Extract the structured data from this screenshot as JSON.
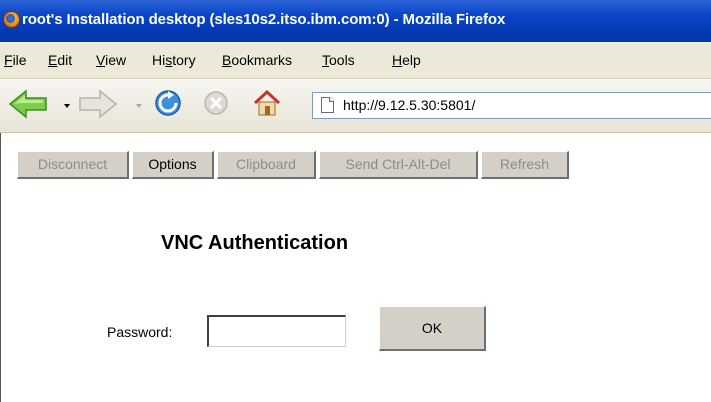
{
  "window": {
    "title": "root's Installation desktop (sles10s2.itso.ibm.com:0) - Mozilla Firefox",
    "app_icon": "firefox-icon"
  },
  "menubar": {
    "items": [
      {
        "label": "File"
      },
      {
        "label": "Edit"
      },
      {
        "label": "View"
      },
      {
        "label": "History"
      },
      {
        "label": "Bookmarks"
      },
      {
        "label": "Tools"
      },
      {
        "label": "Help"
      }
    ]
  },
  "navigation": {
    "back_icon": "back-arrow-icon",
    "forward_icon": "forward-arrow-icon",
    "reload_icon": "reload-icon",
    "stop_icon": "stop-icon",
    "home_icon": "home-icon",
    "url": "http://9.12.5.30:5801/"
  },
  "vnc_toolbar": {
    "buttons": [
      {
        "label": "Disconnect",
        "enabled": false
      },
      {
        "label": "Options",
        "enabled": true
      },
      {
        "label": "Clipboard",
        "enabled": false
      },
      {
        "label": "Send Ctrl-Alt-Del",
        "enabled": false
      },
      {
        "label": "Refresh",
        "enabled": false
      }
    ]
  },
  "auth": {
    "title": "VNC Authentication",
    "password_label": "Password:",
    "password_value": "",
    "ok_label": "OK"
  },
  "colors": {
    "titlebar": "#0a46c8",
    "menubar": "#ece9d8",
    "button_face": "#d4d0c8",
    "disabled_text": "#8c8c8c"
  }
}
